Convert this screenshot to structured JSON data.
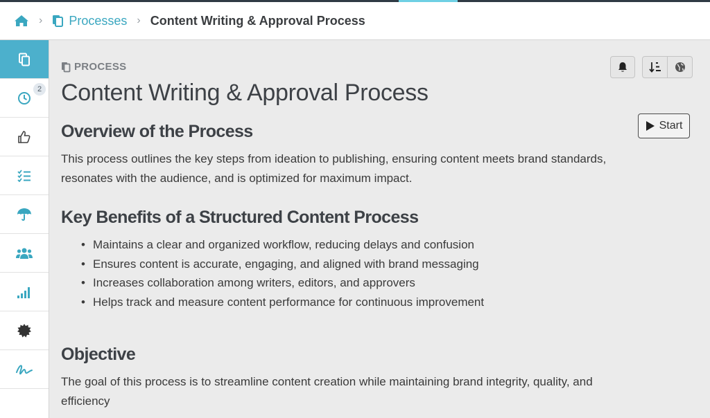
{
  "breadcrumb": {
    "home_icon": "home-icon",
    "separator": "›",
    "processes_label": "Processes",
    "current": "Content Writing & Approval Process"
  },
  "sidebar": {
    "items": [
      {
        "icon": "copy-icon",
        "active": true
      },
      {
        "icon": "clock-icon",
        "badge": "2"
      },
      {
        "icon": "thumbs-up-icon"
      },
      {
        "icon": "checklist-icon"
      },
      {
        "icon": "umbrella-icon"
      },
      {
        "icon": "users-icon"
      },
      {
        "icon": "signal-bars-icon"
      },
      {
        "icon": "gear-icon"
      },
      {
        "icon": "signature-icon"
      }
    ]
  },
  "header": {
    "eyebrow": "PROCESS",
    "title": "Content Writing & Approval Process"
  },
  "toolbar": {
    "bell_icon": "bell-icon",
    "sort_icon": "sort-icon",
    "globe_icon": "globe-icon",
    "start_label": "Start"
  },
  "content": {
    "overview_heading": "Overview of the Process",
    "overview_text": "This process outlines the key steps from ideation to publishing, ensuring content meets brand standards, resonates with the audience, and is optimized for maximum impact.",
    "benefits_heading": "Key Benefits of a Structured Content Process",
    "benefits": [
      "Maintains a clear and organized workflow, reducing delays and confusion",
      "Ensures content is accurate, engaging, and aligned with brand messaging",
      "Increases collaboration among writers, editors, and approvers",
      "Helps track and measure content performance for continuous improvement"
    ],
    "objective_heading": "Objective",
    "objective_text": "The goal of this process is to streamline content creation while maintaining brand integrity, quality, and efficiency"
  },
  "colors": {
    "accent": "#4cb0cc",
    "link": "#3aa7c0",
    "background": "#ebebeb"
  }
}
